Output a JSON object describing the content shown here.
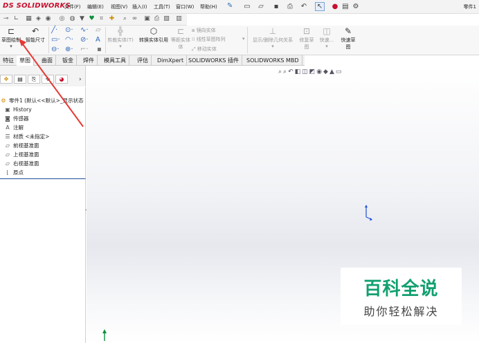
{
  "app": {
    "brand_prefix": "DS",
    "brand_name": "SOLIDWORKS",
    "doc_title": "零件1"
  },
  "menu": [
    "文件(F)",
    "编辑(E)",
    "视图(V)",
    "插入(I)",
    "工具(T)",
    "窗口(W)",
    "帮助(H)"
  ],
  "command_manager": {
    "sketch_button": "草图绘制",
    "smart_dimension_button": "智能尺寸",
    "trim_entities": "剪裁实体(T)",
    "convert_entities": "转换实体引用",
    "offset_entities": "等距实体",
    "offset_entities_2": "体",
    "mirror_entities": "镜向实体",
    "linear_pattern": "线性草图阵列",
    "move_entities": "移动实体",
    "display_relations": "显示/删除几何关系",
    "repair_sketch": "修复草",
    "repair_sketch_2": "图",
    "quick_snap": "快速...",
    "rapid_sketch": "快速草",
    "rapid_sketch_2": "图"
  },
  "tabs": [
    "特征",
    "草图",
    "曲面",
    "钣金",
    "焊件",
    "模具工具",
    "评估",
    "DimXpert",
    "SOLIDWORKS 插件",
    "SOLIDWORKS MBD"
  ],
  "tree": {
    "root": "零件1 (默认<<默认>_显示状态",
    "items": [
      {
        "icon": "history-icon",
        "label": "History"
      },
      {
        "icon": "sensor-icon",
        "label": "传感器"
      },
      {
        "icon": "annotation-icon",
        "label": "注解"
      },
      {
        "icon": "material-icon",
        "label": "材质 <未指定>"
      },
      {
        "icon": "plane-icon",
        "label": "前视基准面"
      },
      {
        "icon": "plane-icon",
        "label": "上视基准面"
      },
      {
        "icon": "plane-icon",
        "label": "右视基准面"
      },
      {
        "icon": "origin-icon",
        "label": "原点"
      }
    ]
  },
  "watermark": {
    "title": "百科全说",
    "subtitle": "助你轻松解决"
  },
  "colors": {
    "accent_red": "#c8102e",
    "watermark_green": "#11a06f",
    "link_blue": "#1d4e9e"
  }
}
